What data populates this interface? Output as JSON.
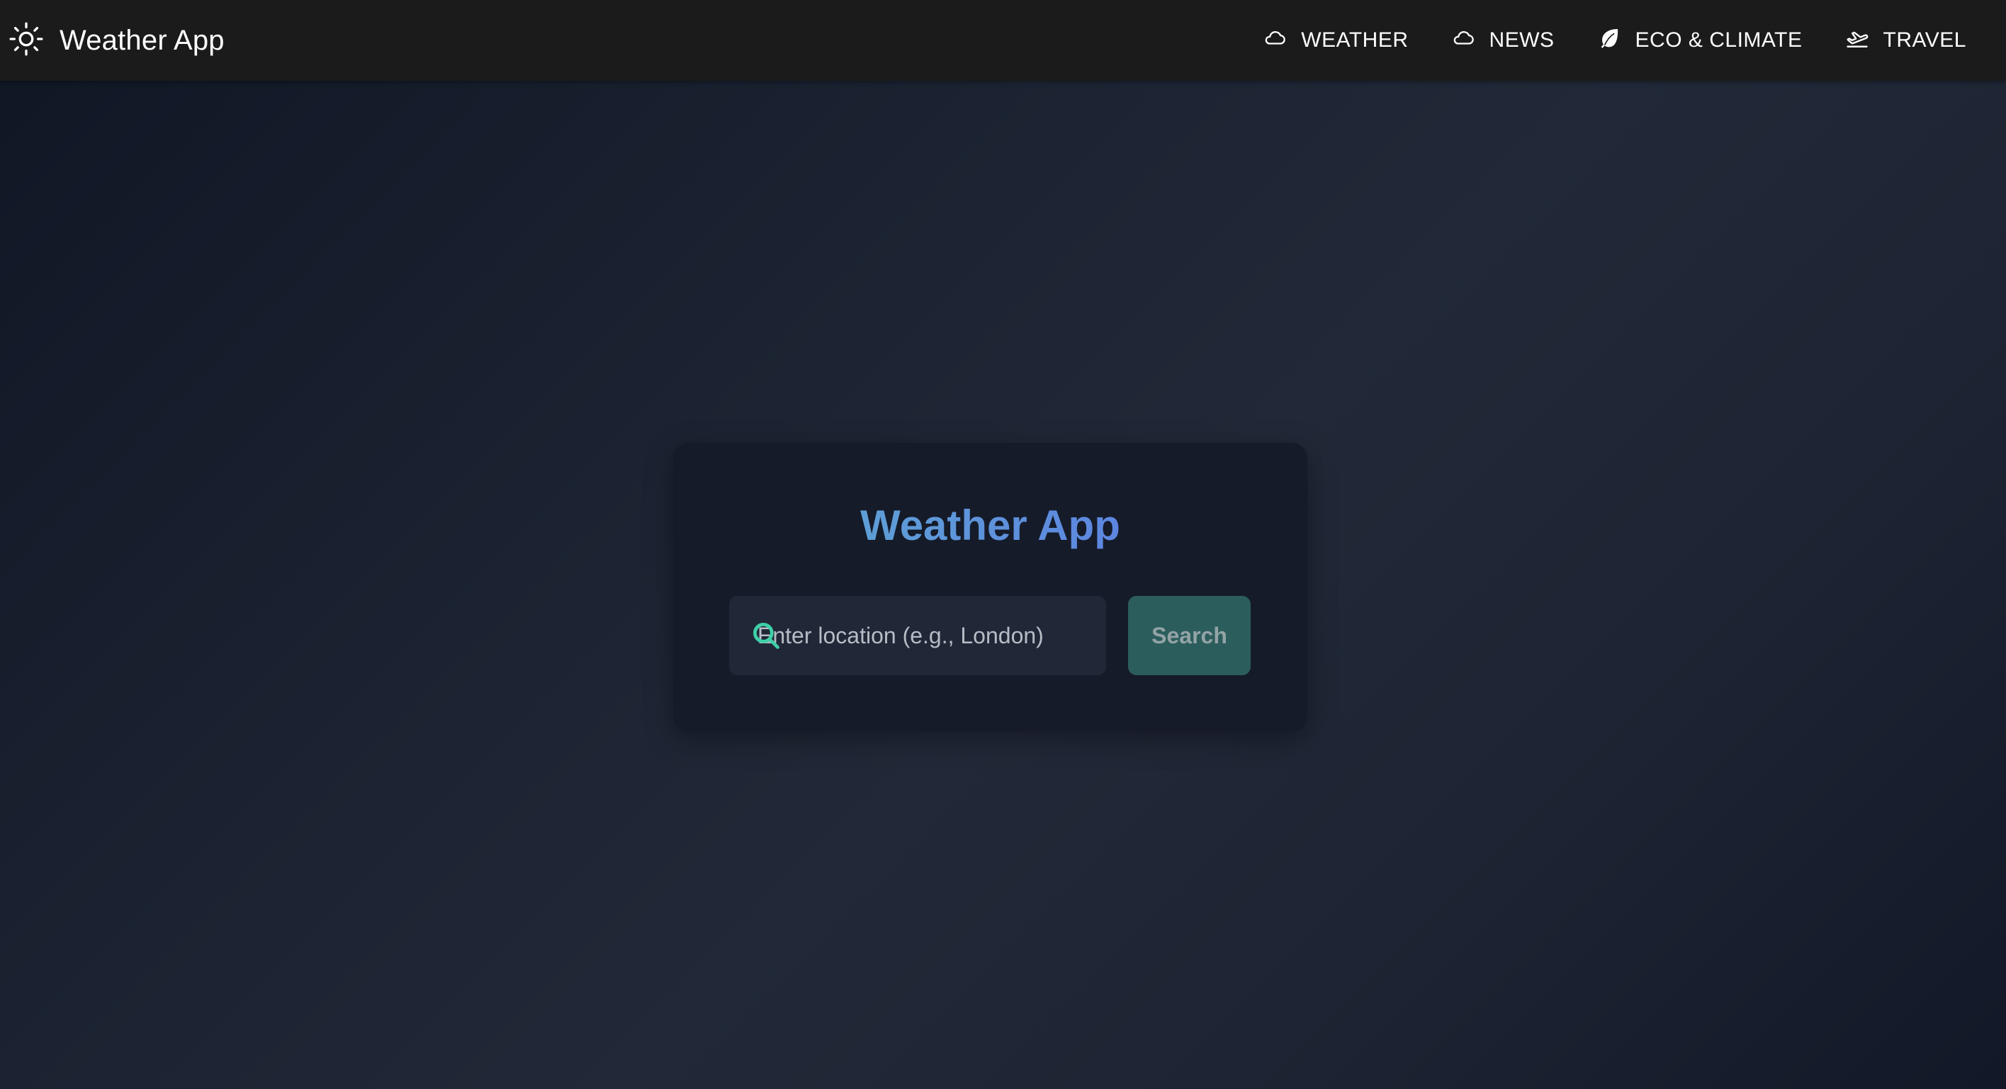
{
  "navbar": {
    "brand_label": "Weather App",
    "brand_icon": "sun-icon",
    "items": [
      {
        "label": "WEATHER",
        "icon": "cloud-icon"
      },
      {
        "label": "NEWS",
        "icon": "cloud-icon"
      },
      {
        "label": "ECO & CLIMATE",
        "icon": "leaf-icon"
      },
      {
        "label": "TRAVEL",
        "icon": "plane-takeoff-icon"
      }
    ]
  },
  "card": {
    "title": "Weather App",
    "search": {
      "placeholder": "Enter location (e.g., London)",
      "value": "",
      "icon": "search-icon"
    },
    "button_label": "Search"
  },
  "colors": {
    "nav_background": "#1b1b1b",
    "card_background": "#151b29",
    "title_gradient_start": "#5fb0cf",
    "title_gradient_end": "#6670e8",
    "button_background": "#2c5d5d",
    "search_icon": "#3fd0a8"
  }
}
